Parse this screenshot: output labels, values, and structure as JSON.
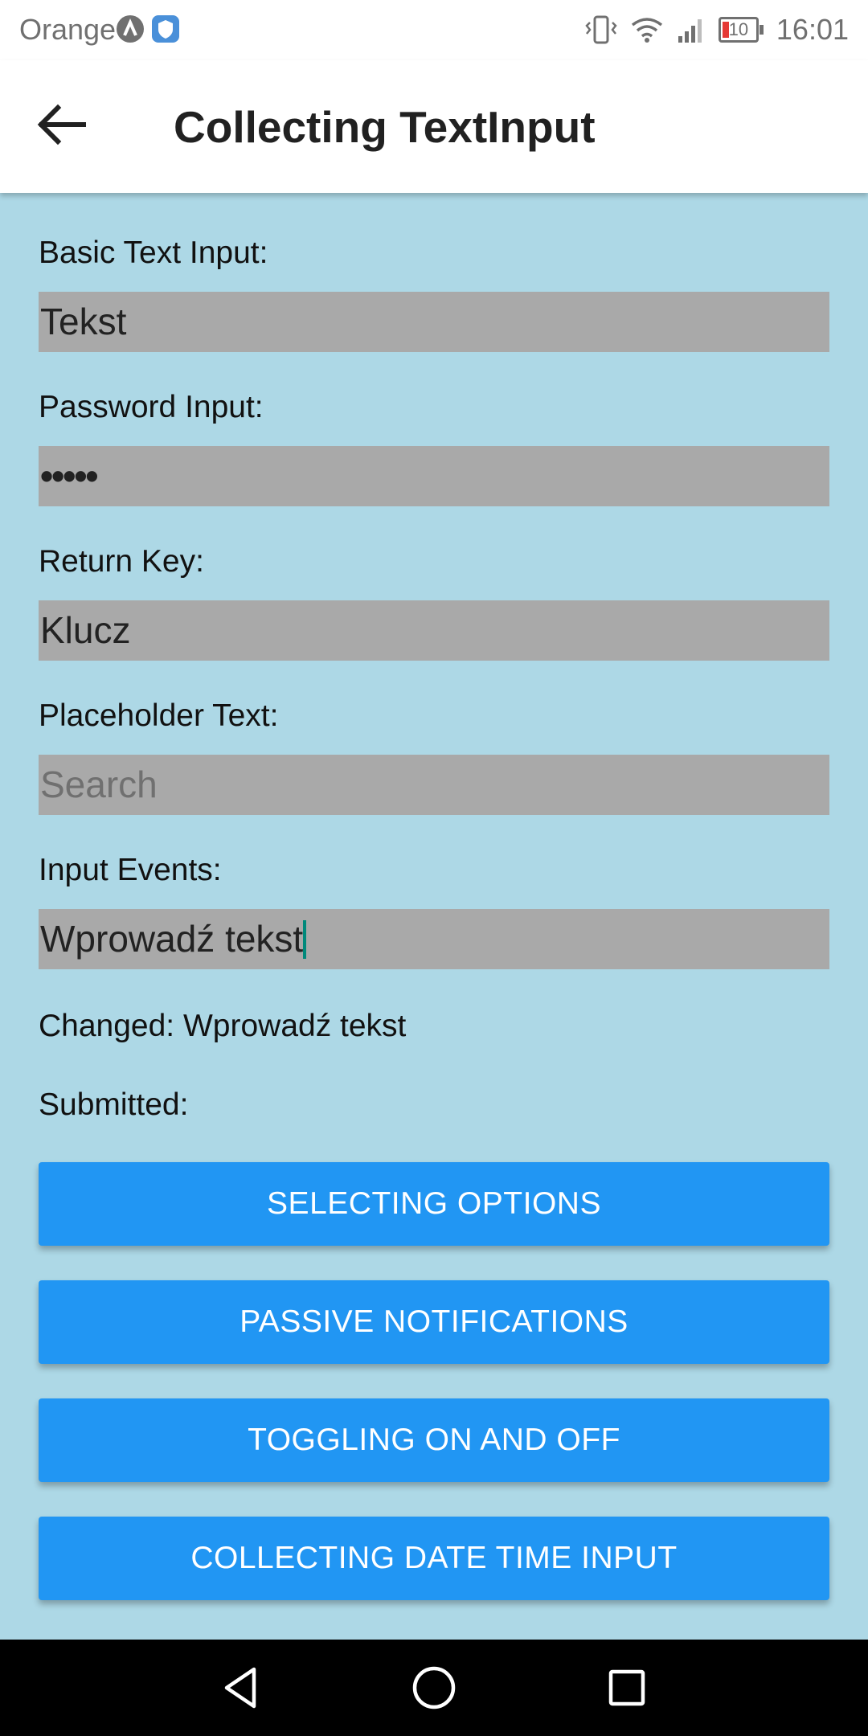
{
  "status_bar": {
    "carrier": "Orange",
    "battery": "10",
    "time": "16:01"
  },
  "app_bar": {
    "title": "Collecting TextInput"
  },
  "fields": [
    {
      "label": "Basic Text Input:",
      "value": "Tekst"
    },
    {
      "label": "Password Input:",
      "value": "•••••"
    },
    {
      "label": "Return Key:",
      "value": "Klucz"
    },
    {
      "label": "Placeholder Text:",
      "placeholder": "Search"
    },
    {
      "label": "Input Events:",
      "value": "Wprowadź tekst"
    }
  ],
  "events": {
    "changed": "Changed: Wprowadź tekst",
    "submitted": "Submitted:"
  },
  "buttons": [
    {
      "label": "SELECTING OPTIONS"
    },
    {
      "label": "PASSIVE NOTIFICATIONS"
    },
    {
      "label": "TOGGLING ON AND OFF"
    },
    {
      "label": "COLLECTING DATE TIME INPUT"
    }
  ],
  "colors": {
    "background": "#ADD8E6",
    "input_bg": "#A9A9A9",
    "button_bg": "#2196F3",
    "caret": "#00897B"
  }
}
